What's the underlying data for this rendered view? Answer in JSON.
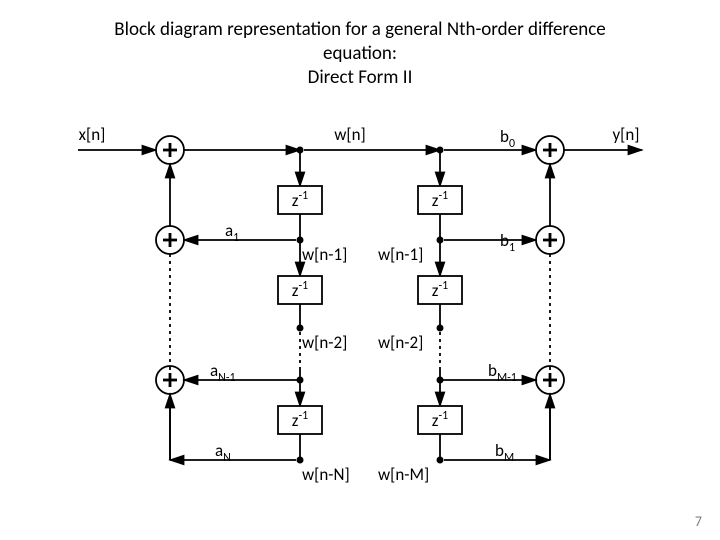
{
  "title_line1": "Block diagram representation for a general Nth-order difference",
  "title_line2": "equation:",
  "title_line3": "Direct Form II",
  "page_number": "7",
  "io": {
    "x": "x[n]",
    "y": "y[n]"
  },
  "mid_top": "w[n]",
  "mid_r1_left": "w[n-1]",
  "mid_r1_right": "w[n-1]",
  "mid_r2_left": "w[n-2]",
  "mid_r2_right": "w[n-2]",
  "mid_r3_left": "w[n-N]",
  "mid_r3_right": "w[n-M]",
  "delay": "z",
  "delay_sup": "-1",
  "coef": {
    "a1": {
      "base": "a",
      "sub": "1"
    },
    "aNm1": {
      "base": "a",
      "sub": "N-1"
    },
    "aN": {
      "base": "a",
      "sub": "N"
    },
    "b0": {
      "base": "b",
      "sub": "0"
    },
    "b1": {
      "base": "b",
      "sub": "1"
    },
    "bMm1": {
      "base": "b",
      "sub": "M-1"
    },
    "bM": {
      "base": "b",
      "sub": "M"
    }
  }
}
